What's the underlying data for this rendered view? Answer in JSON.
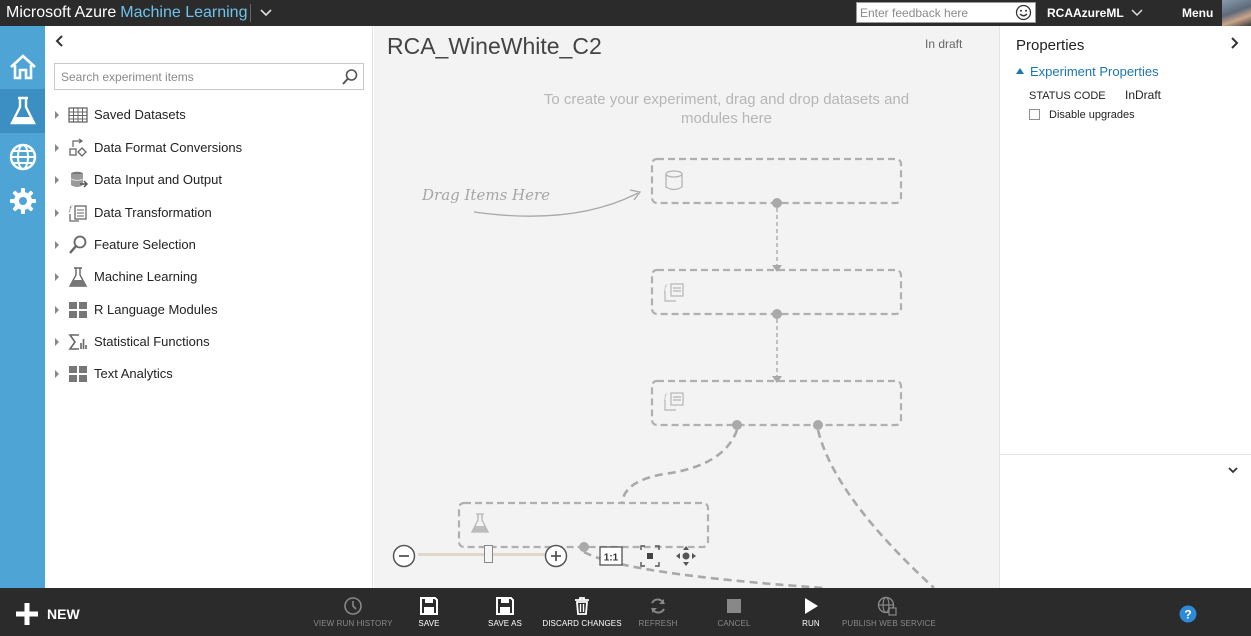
{
  "brand": {
    "company": "Microsoft Azure",
    "product": "Machine Learning"
  },
  "header": {
    "feedback_placeholder": "Enter feedback here",
    "user_name": "RCAAzureML",
    "menu_label": "Menu"
  },
  "palette": {
    "search_placeholder": "Search experiment items",
    "categories": [
      {
        "label": "Saved Datasets",
        "icon": "dataset-icon"
      },
      {
        "label": "Data Format Conversions",
        "icon": "format-conversion-icon"
      },
      {
        "label": "Data Input and Output",
        "icon": "data-io-icon"
      },
      {
        "label": "Data Transformation",
        "icon": "transformation-icon"
      },
      {
        "label": "Feature Selection",
        "icon": "magnifier-icon"
      },
      {
        "label": "Machine Learning",
        "icon": "flask-icon"
      },
      {
        "label": "R Language Modules",
        "icon": "module-grid-icon"
      },
      {
        "label": "Statistical Functions",
        "icon": "sigma-icon"
      },
      {
        "label": "Text Analytics",
        "icon": "module-grid-icon"
      }
    ]
  },
  "canvas": {
    "title": "RCA_WineWhite_C2",
    "status": "In draft",
    "hint": "To create your experiment, drag and drop datasets and modules here",
    "drag_label": "Drag Items Here",
    "fit_label": "1:1"
  },
  "properties": {
    "title": "Properties",
    "section": "Experiment Properties",
    "status_code_label": "STATUS CODE",
    "status_code_value": "InDraft",
    "disable_upgrades_label": "Disable upgrades"
  },
  "toolbar": {
    "new_label": "NEW",
    "buttons": [
      {
        "label": "VIEW RUN HISTORY",
        "icon": "history-icon",
        "enabled": false
      },
      {
        "label": "SAVE",
        "icon": "save-icon",
        "enabled": true
      },
      {
        "label": "SAVE AS",
        "icon": "save-as-icon",
        "enabled": true
      },
      {
        "label": "DISCARD CHANGES",
        "icon": "trash-icon",
        "enabled": true
      },
      {
        "label": "REFRESH",
        "icon": "refresh-icon",
        "enabled": false
      },
      {
        "label": "CANCEL",
        "icon": "stop-icon",
        "enabled": false
      },
      {
        "label": "RUN",
        "icon": "play-icon",
        "enabled": true
      },
      {
        "label": "PUBLISH WEB SERVICE",
        "icon": "globe-icon",
        "enabled": false
      }
    ]
  },
  "colors": {
    "topbar": "#2b2b2b",
    "nav": "#4fa4d6",
    "nav_active": "#3b8fc2",
    "accent_text": "#6fc3ea",
    "link": "#1c76b3",
    "canvas": "#f3f3f3"
  }
}
